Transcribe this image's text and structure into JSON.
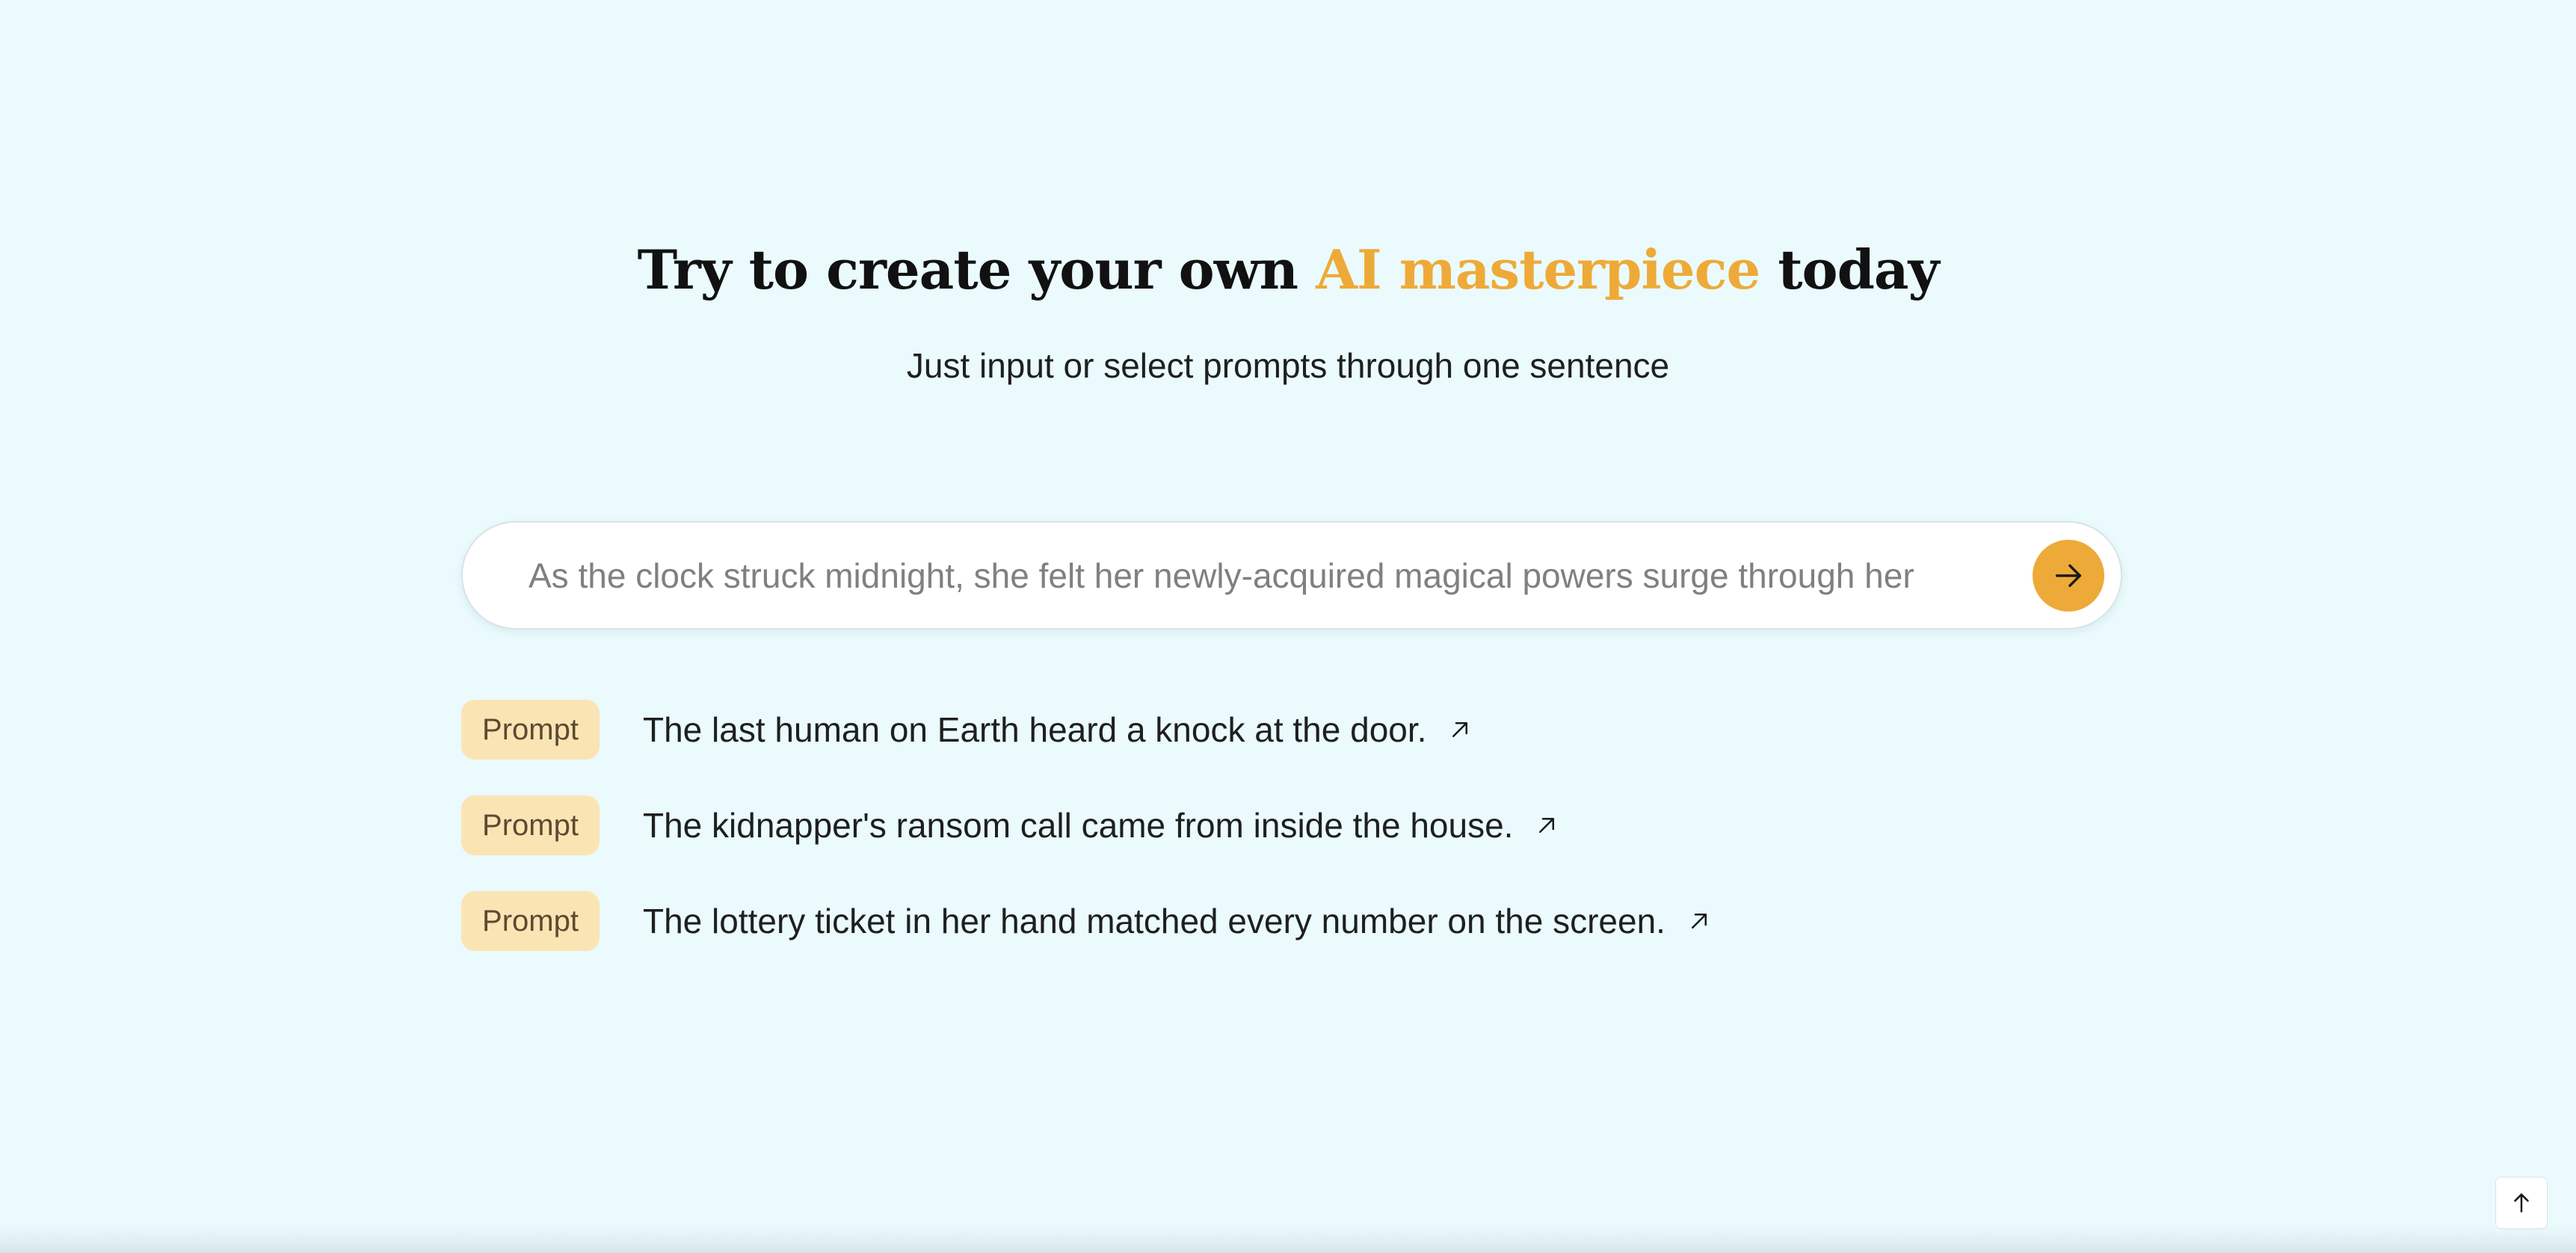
{
  "hero": {
    "title_prefix": "Try to create your own ",
    "title_accent": "AI masterpiece",
    "title_suffix": " today",
    "subtitle": "Just input or select prompts through one sentence"
  },
  "search": {
    "placeholder": "As the clock struck midnight, she felt her newly-acquired magical powers surge through her",
    "value": "",
    "send_icon": "arrow-right-icon"
  },
  "prompts": [
    {
      "badge": "Prompt",
      "text": "The last human on Earth heard a knock at the door.",
      "icon": "arrow-up-right-icon"
    },
    {
      "badge": "Prompt",
      "text": "The kidnapper's ransom call came from inside the house.",
      "icon": "arrow-up-right-icon"
    },
    {
      "badge": "Prompt",
      "text": "The lottery ticket in her hand matched every number on the screen.",
      "icon": "arrow-up-right-icon"
    }
  ],
  "scroll_top": {
    "icon": "arrow-up-icon"
  },
  "colors": {
    "background": "#eafafd",
    "accent": "#eeaa38",
    "badge_bg": "#fbe4b4",
    "text": "#1f1f1f"
  }
}
